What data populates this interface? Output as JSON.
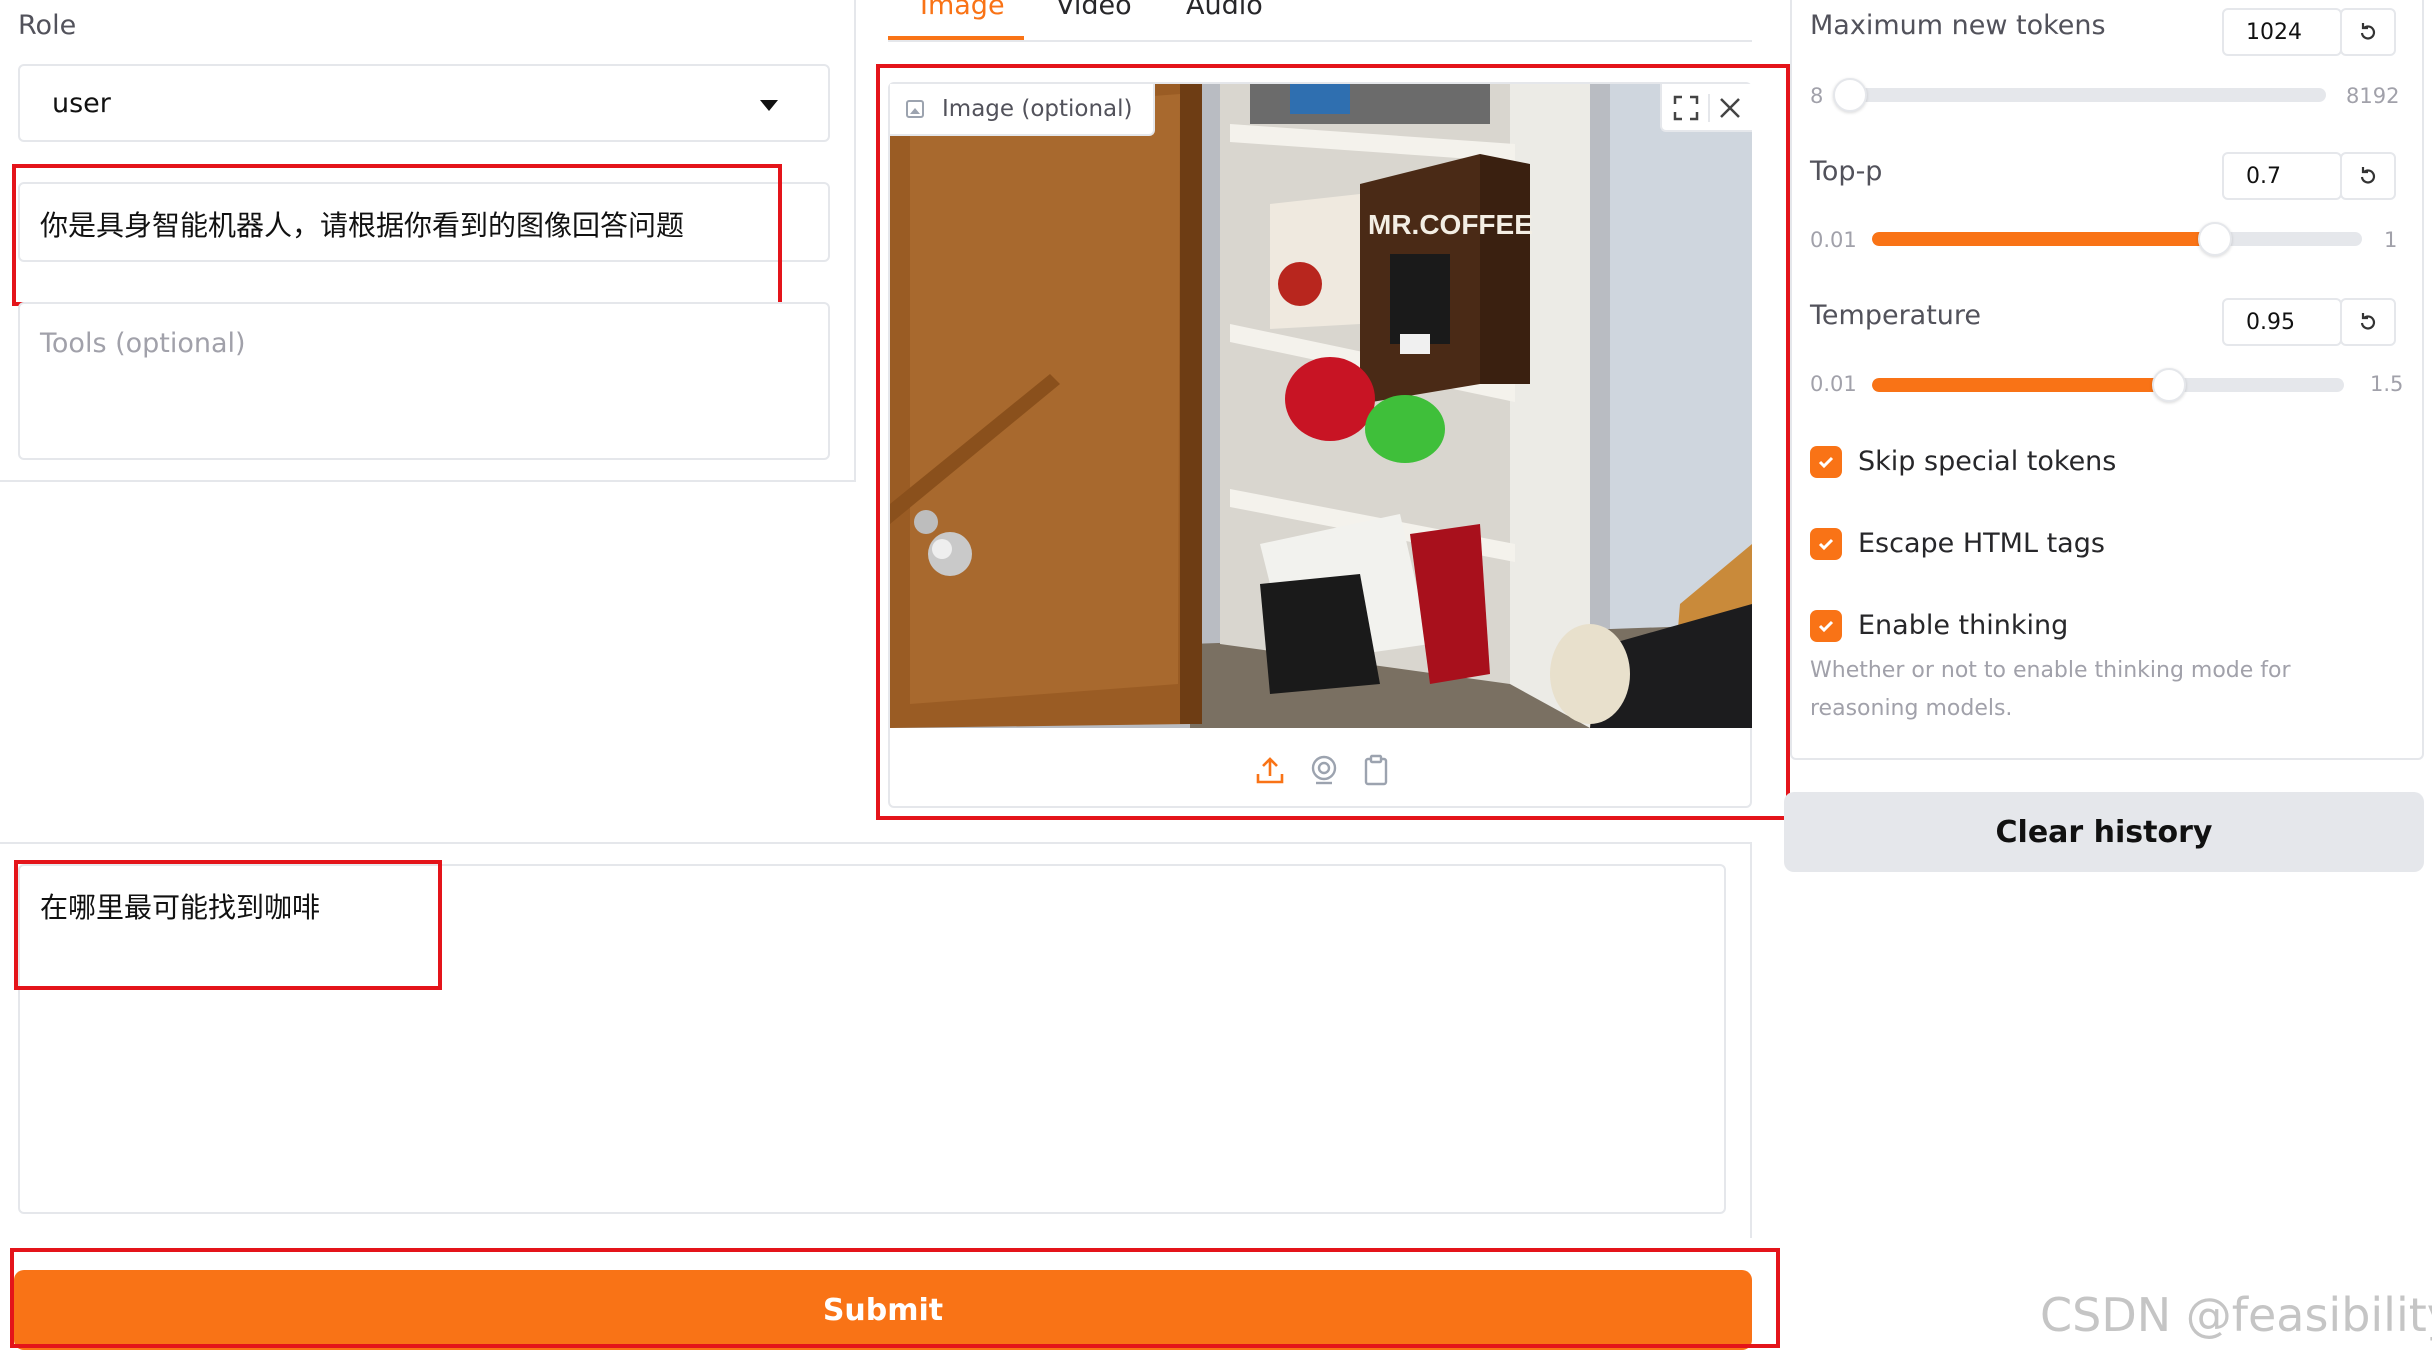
{
  "left": {
    "role_label": "Role",
    "role_value": "user",
    "system_text": "你是具身智能机器人，请根据你看到的图像回答问题",
    "tools_placeholder": "Tools (optional)"
  },
  "media": {
    "tabs": [
      {
        "label": "Image",
        "active": true
      },
      {
        "label": "Video",
        "active": false
      },
      {
        "label": "Audio",
        "active": false
      }
    ],
    "image_label": "Image (optional)",
    "photo_brand_text": "MR.COFFEE"
  },
  "message": {
    "text": "在哪里最可能找到咖啡"
  },
  "submit_label": "Submit",
  "settings": {
    "max_tokens": {
      "label": "Maximum new tokens",
      "value": "1024",
      "min": "8",
      "max": "8192",
      "fraction": 0.02
    },
    "top_p": {
      "label": "Top-p",
      "value": "0.7",
      "min": "0.01",
      "max": "1",
      "fraction": 0.7
    },
    "temperature": {
      "label": "Temperature",
      "value": "0.95",
      "min": "0.01",
      "max": "1.5",
      "fraction": 0.63
    },
    "checkboxes": [
      {
        "label": "Skip special tokens",
        "checked": true
      },
      {
        "label": "Escape HTML tags",
        "checked": true
      },
      {
        "label": "Enable thinking",
        "checked": true,
        "info": "Whether or not to enable thinking mode for reasoning models."
      }
    ],
    "clear_label": "Clear history"
  },
  "watermark": "CSDN @feasibility.",
  "colors": {
    "accent": "#f97316",
    "annotation": "#e4141a",
    "border": "#e5e7eb"
  }
}
